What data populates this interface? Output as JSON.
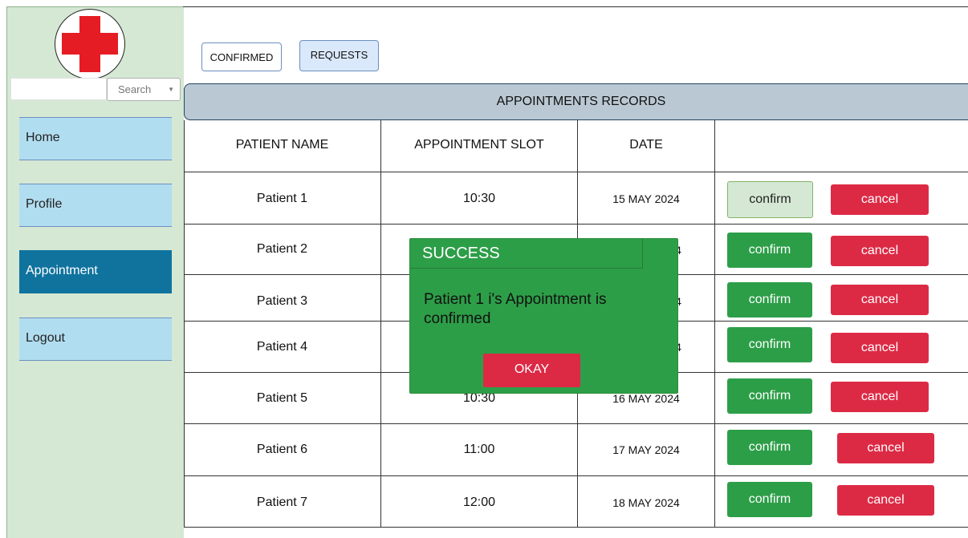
{
  "sidebar": {
    "search_label": "Search",
    "nav": [
      {
        "label": "Home",
        "active": false
      },
      {
        "label": "Profile",
        "active": false
      },
      {
        "label": "Appointment",
        "active": true
      },
      {
        "label": "Logout",
        "active": false
      }
    ]
  },
  "tabs": {
    "confirmed": "CONFIRMED",
    "requests": "REQUESTS"
  },
  "table": {
    "title": "APPOINTMENTS RECORDS",
    "columns": [
      "PATIENT NAME",
      "APPOINTMENT SLOT",
      "DATE",
      ""
    ],
    "rows": [
      {
        "name": "Patient 1",
        "slot": "10:30",
        "date": "15 MAY 2024",
        "confirm": "confirm",
        "cancel": "cancel",
        "confirmed": true
      },
      {
        "name": "Patient 2",
        "slot": "",
        "date": "4",
        "confirm": "confirm",
        "cancel": "cancel",
        "confirmed": false
      },
      {
        "name": "Patient 3",
        "slot": "",
        "date": "4",
        "confirm": "confirm",
        "cancel": "cancel",
        "confirmed": false
      },
      {
        "name": "Patient 4",
        "slot": "",
        "date": "4",
        "confirm": "confirm",
        "cancel": "cancel",
        "confirmed": false
      },
      {
        "name": "Patient 5",
        "slot": "10:30",
        "date": "16 MAY 2024",
        "confirm": "confirm",
        "cancel": "cancel",
        "confirmed": false
      },
      {
        "name": "Patient 6",
        "slot": "11:00",
        "date": "17 MAY 2024",
        "confirm": "confirm",
        "cancel": "cancel",
        "confirmed": false
      },
      {
        "name": "Patient 7",
        "slot": "12:00",
        "date": "18 MAY 2024",
        "confirm": "confirm",
        "cancel": "cancel",
        "confirmed": false
      }
    ]
  },
  "dialog": {
    "title": "SUCCESS",
    "message": "Patient 1 i's  Appointment is confirmed",
    "ok_label": "OKAY"
  },
  "colors": {
    "sidebar_bg": "#d5e8d4",
    "nav_bg": "#b1ddf0",
    "nav_active_bg": "#10739e",
    "confirm_green": "#2d9e48",
    "cancel_red": "#dc2a45",
    "header_bg": "#bac8d3"
  }
}
